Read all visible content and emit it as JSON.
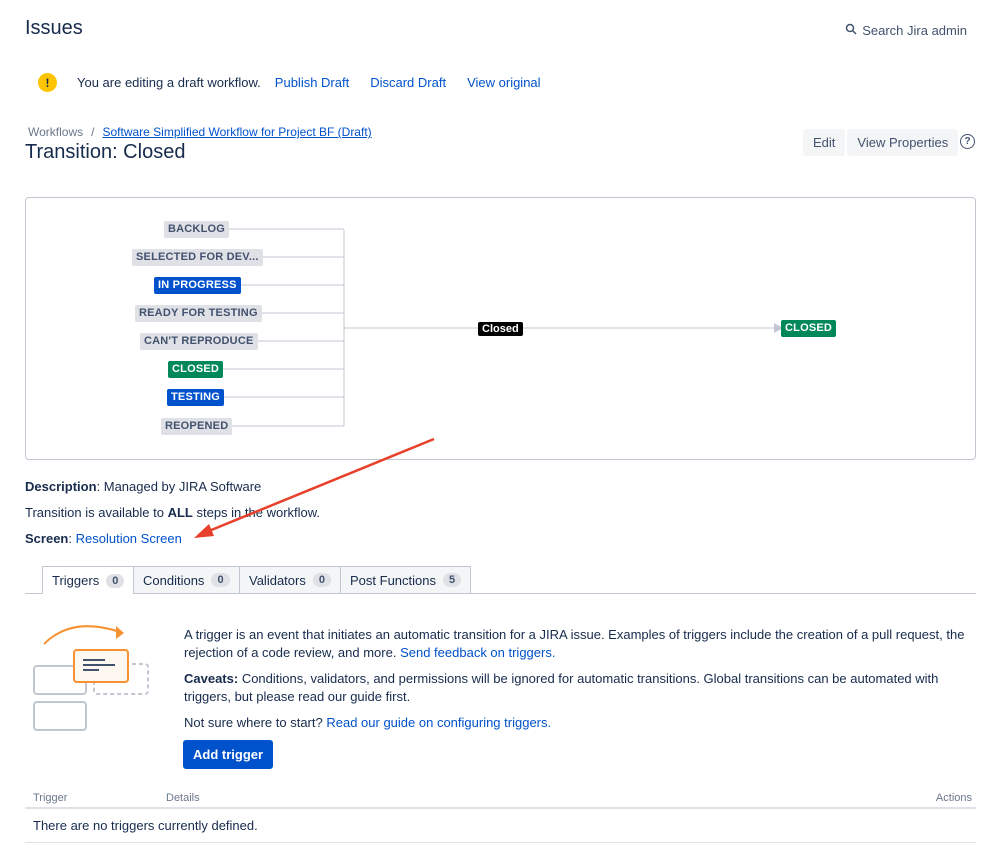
{
  "header": {
    "title": "Issues",
    "search_label": "Search Jira admin"
  },
  "draft_bar": {
    "message": "You are editing a draft workflow.",
    "publish": "Publish Draft",
    "discard": "Discard Draft",
    "view_original": "View original"
  },
  "breadcrumb": {
    "root": "Workflows",
    "separator": "/",
    "workflow": "Software Simplified Workflow for Project BF (Draft)"
  },
  "transition_title": "Transition: Closed",
  "actions": {
    "edit": "Edit",
    "view_properties": "View Properties",
    "help": "?"
  },
  "diagram": {
    "from_statuses": [
      {
        "label": "BACKLOG",
        "color": "gray"
      },
      {
        "label": "SELECTED FOR DEV...",
        "color": "gray"
      },
      {
        "label": "IN PROGRESS",
        "color": "blue"
      },
      {
        "label": "READY FOR TESTING",
        "color": "gray"
      },
      {
        "label": "CAN'T REPRODUCE",
        "color": "gray"
      },
      {
        "label": "CLOSED",
        "color": "green"
      },
      {
        "label": "TESTING",
        "color": "blue"
      },
      {
        "label": "REOPENED",
        "color": "gray"
      }
    ],
    "transition_label": "Closed",
    "to_status": {
      "label": "CLOSED",
      "color": "green"
    }
  },
  "info": {
    "description_label": "Description",
    "description_value": ": Managed by JIRA Software",
    "available_prefix": "Transition is available to ",
    "available_bold": "ALL",
    "available_suffix": " steps in the workflow.",
    "screen_label": "Screen",
    "screen_sep": ": ",
    "screen_value": "Resolution Screen"
  },
  "tabs": [
    {
      "label": "Triggers",
      "count": "0",
      "active": true
    },
    {
      "label": "Conditions",
      "count": "0",
      "active": false
    },
    {
      "label": "Validators",
      "count": "0",
      "active": false
    },
    {
      "label": "Post Functions",
      "count": "5",
      "active": false
    }
  ],
  "triggers": {
    "intro": "A trigger is an event that initiates an automatic transition for a JIRA issue. Examples of triggers include the creation of a pull request, the rejection of a code review, and more.",
    "feedback_link": "Send feedback on triggers.",
    "caveats_label": "Caveats:",
    "caveats_text": " Conditions, validators, and permissions will be ignored for automatic transitions. Global transitions can be automated with triggers, but please read our guide first.",
    "not_sure": "Not sure where to start?",
    "guide_link": "Read our guide on configuring triggers.",
    "add_button": "Add trigger",
    "table_headers": {
      "trigger": "Trigger",
      "details": "Details",
      "actions": "Actions"
    },
    "empty_message": "There are no triggers currently defined."
  },
  "colors": {
    "link": "#0052cc",
    "status_gray": "#dfe1e6",
    "status_blue": "#0052cc",
    "status_green": "#00875a",
    "annotation_arrow": "#e8402a",
    "illustration_orange": "#f79232"
  }
}
